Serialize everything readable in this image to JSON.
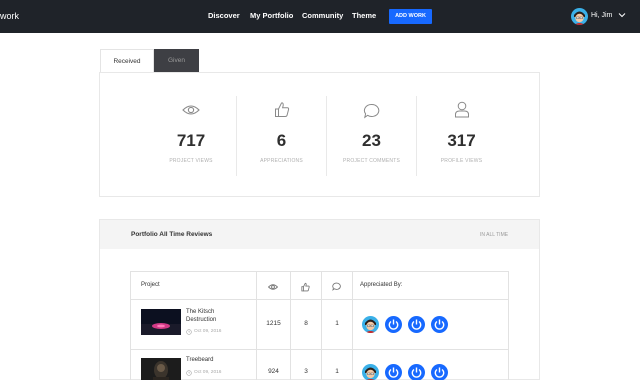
{
  "topnav": {
    "brand": "work",
    "links": [
      "Discover",
      "My Portfolio",
      "Community",
      "Theme"
    ],
    "add_button": "ADD WORK",
    "greeting": "Hi, Jim"
  },
  "tabs": [
    "Received",
    "Given"
  ],
  "stats": [
    {
      "icon": "eye-icon",
      "value": "717",
      "label": "PROJECT VIEWS"
    },
    {
      "icon": "thumbs-up-icon",
      "value": "6",
      "label": "APPRECIATIONS"
    },
    {
      "icon": "comment-icon",
      "value": "23",
      "label": "PROJECT COMMENTS"
    },
    {
      "icon": "person-icon",
      "value": "317",
      "label": "PROFILE VIEWS"
    }
  ],
  "reviews": {
    "title": "Portfolio All Time Reviews",
    "range": "IN ALL TIME",
    "columns": {
      "project": "Project",
      "views_icon": "eye-icon",
      "likes_icon": "thumbs-up-icon",
      "comments_icon": "comment-icon",
      "appreciated": "Appreciated By:"
    },
    "rows": [
      {
        "title": "The Kitsch Destruction",
        "date": "Oct 09, 2016",
        "views": "1215",
        "likes": "8",
        "comments": "1"
      },
      {
        "title": "Treebeard",
        "date": "Oct 09, 2016",
        "views": "924",
        "likes": "3",
        "comments": "1"
      }
    ]
  },
  "colors": {
    "nav_bg": "#1f2329",
    "accent": "#1769ff"
  }
}
